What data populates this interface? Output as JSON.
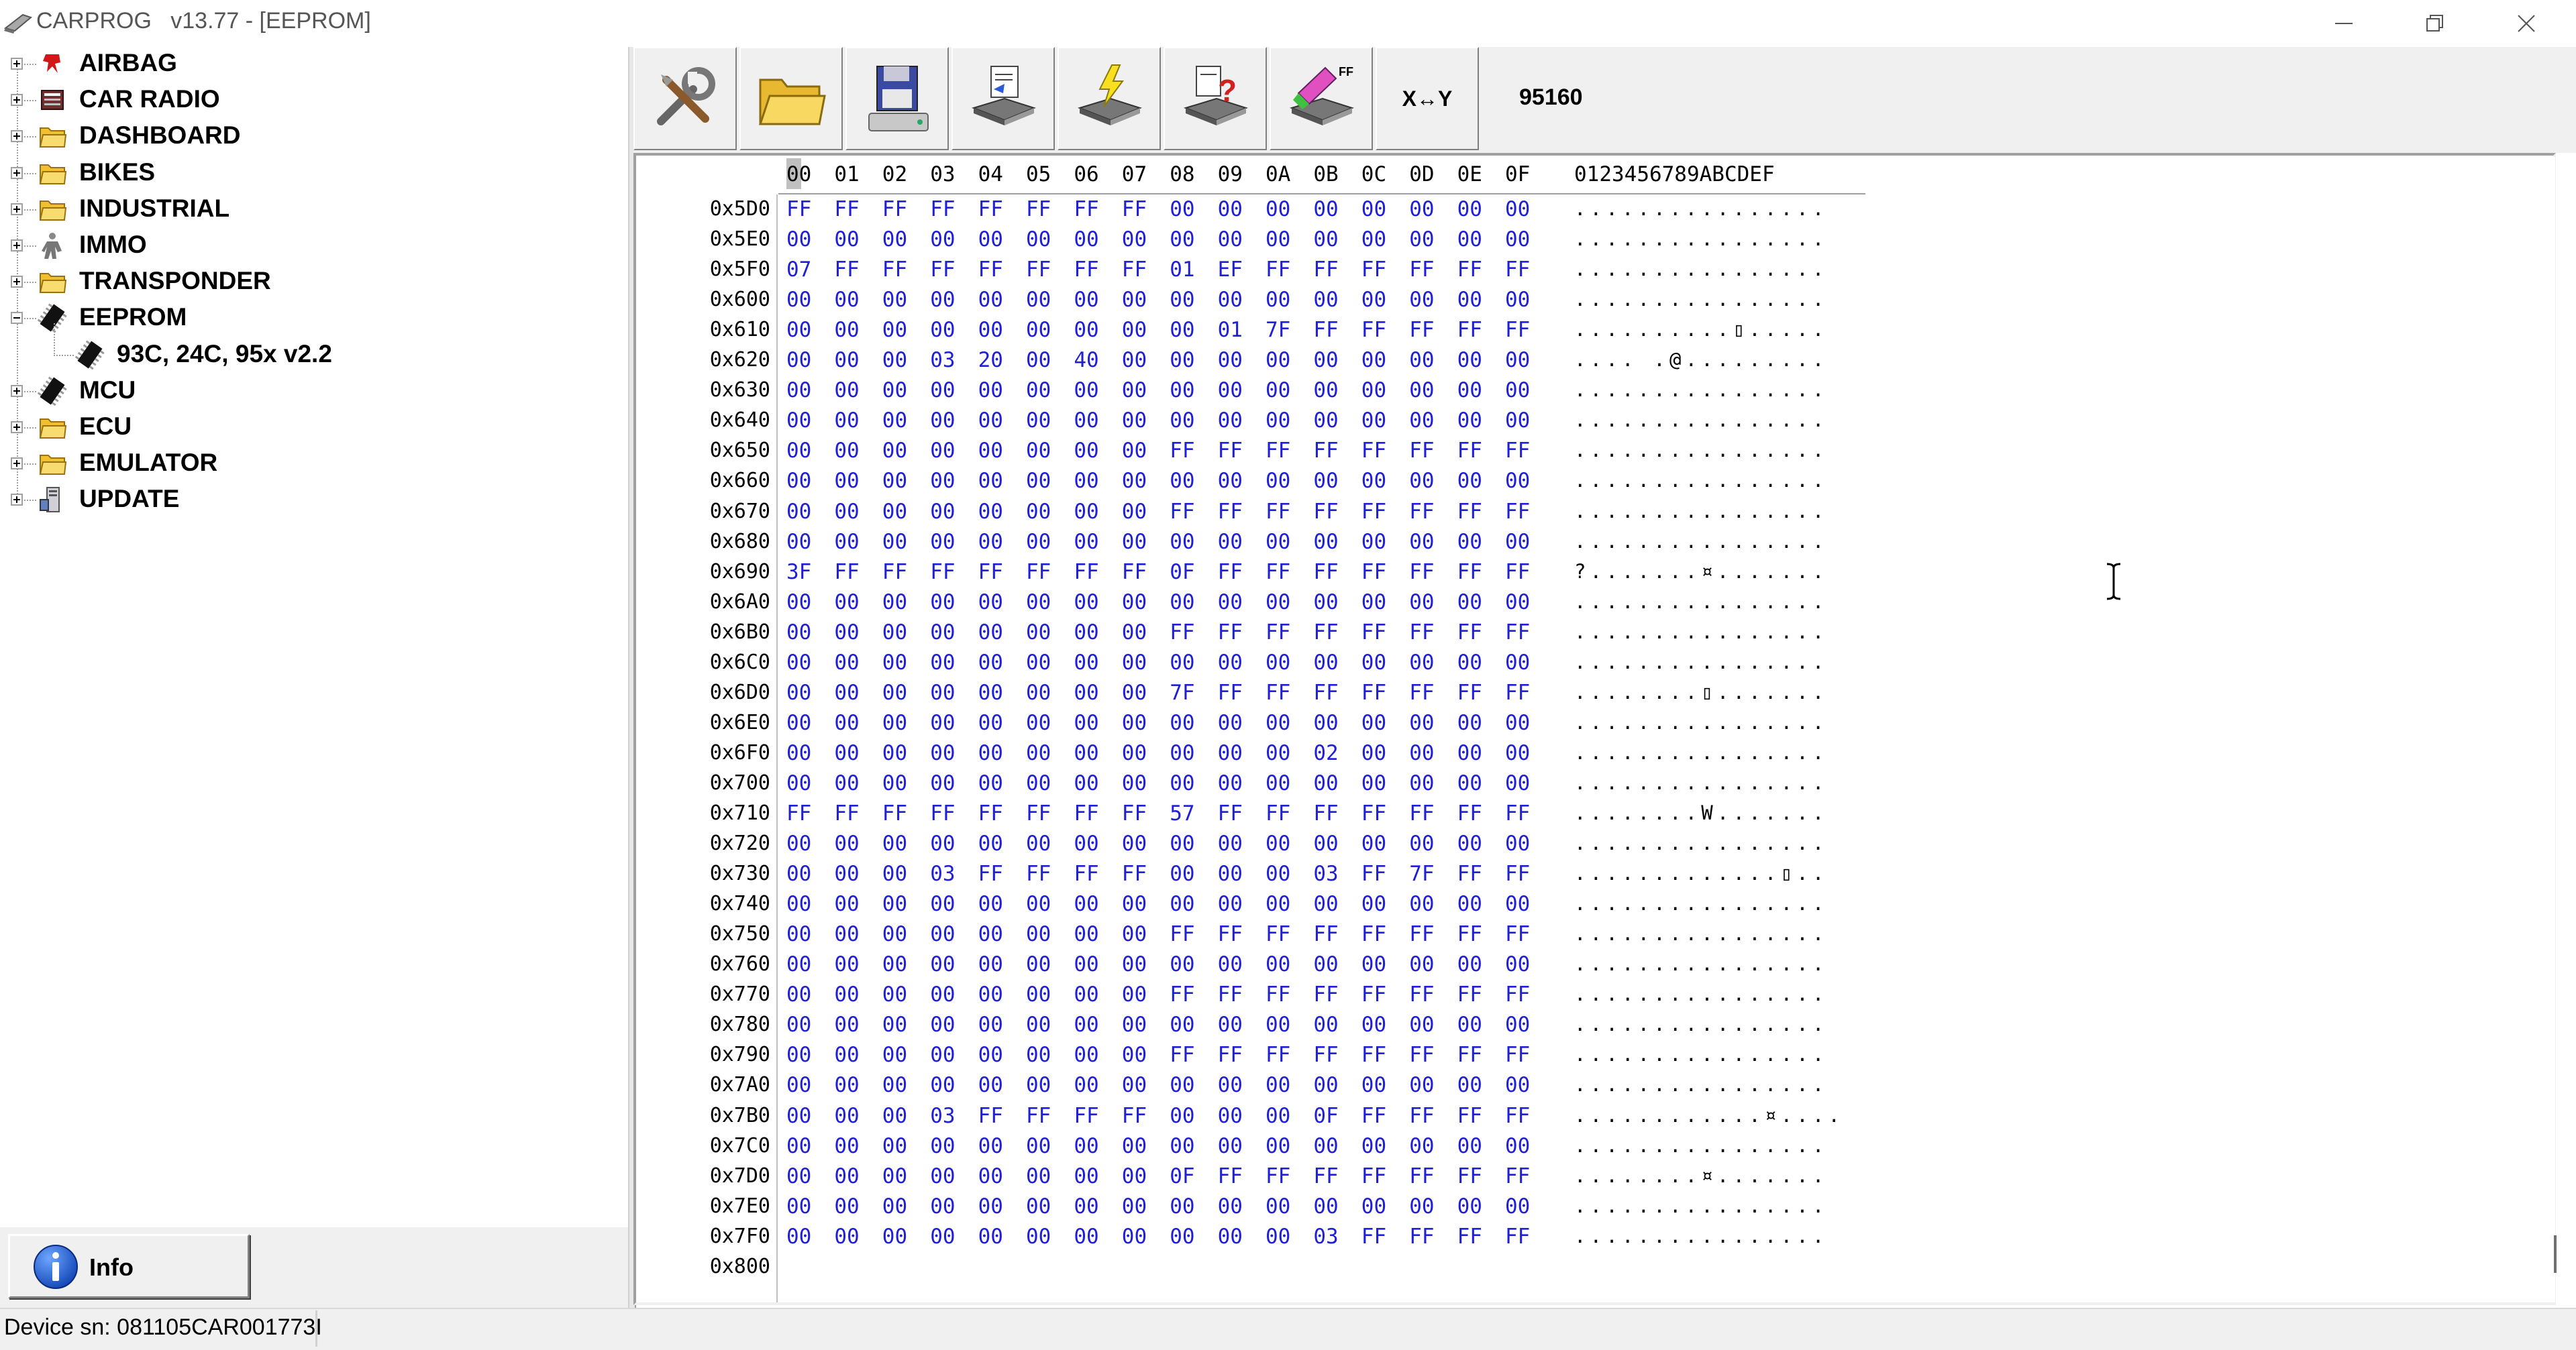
{
  "window": {
    "app_name": "CARPROG",
    "title": "CARPROG   v13.77 - [EEPROM]"
  },
  "tree": {
    "items": [
      {
        "label": "AIRBAG",
        "icon": "airbag-icon",
        "expander": "plus"
      },
      {
        "label": "CAR RADIO",
        "icon": "car-radio-icon",
        "expander": "plus"
      },
      {
        "label": "DASHBOARD",
        "icon": "folder-icon",
        "expander": "plus"
      },
      {
        "label": "BIKES",
        "icon": "folder-icon",
        "expander": "plus"
      },
      {
        "label": "INDUSTRIAL",
        "icon": "folder-icon",
        "expander": "plus"
      },
      {
        "label": "IMMO",
        "icon": "immo-icon",
        "expander": "plus"
      },
      {
        "label": "TRANSPONDER",
        "icon": "folder-icon",
        "expander": "plus"
      },
      {
        "label": "EEPROM",
        "icon": "chip-icon",
        "expander": "minus"
      },
      {
        "label": "93C, 24C, 95x v2.2",
        "icon": "chip-icon",
        "expander": "none"
      },
      {
        "label": "MCU",
        "icon": "chip-icon",
        "expander": "plus"
      },
      {
        "label": "ECU",
        "icon": "folder-icon",
        "expander": "plus"
      },
      {
        "label": "EMULATOR",
        "icon": "folder-icon",
        "expander": "plus"
      },
      {
        "label": "UPDATE",
        "icon": "update-icon",
        "expander": "plus"
      }
    ]
  },
  "info_button": {
    "label": "Info"
  },
  "toolbar": {
    "buttons": [
      {
        "name": "settings-tools-button",
        "icon": "tools-icon"
      },
      {
        "name": "open-file-button",
        "icon": "folder-open-icon"
      },
      {
        "name": "save-file-button",
        "icon": "save-icon"
      },
      {
        "name": "read-chip-button",
        "icon": "read-chip-icon"
      },
      {
        "name": "write-chip-button",
        "icon": "write-chip-icon"
      },
      {
        "name": "verify-chip-button",
        "icon": "verify-chip-icon"
      },
      {
        "name": "erase-chip-button",
        "icon": "erase-chip-icon"
      },
      {
        "name": "swap-xy-button",
        "label": "X↔Y"
      }
    ],
    "device_id": "95160"
  },
  "hex_view": {
    "header": [
      "00",
      "01",
      "02",
      "03",
      "04",
      "05",
      "06",
      "07",
      "08",
      "09",
      "0A",
      "0B",
      "0C",
      "0D",
      "0E",
      "0F"
    ],
    "ascii_header": "0123456789ABCDEF",
    "rows": [
      {
        "addr": "0x5D0",
        "bytes": [
          "FF",
          "FF",
          "FF",
          "FF",
          "FF",
          "FF",
          "FF",
          "FF",
          "00",
          "00",
          "00",
          "00",
          "00",
          "00",
          "00",
          "00"
        ],
        "ascii": "................"
      },
      {
        "addr": "0x5E0",
        "bytes": [
          "00",
          "00",
          "00",
          "00",
          "00",
          "00",
          "00",
          "00",
          "00",
          "00",
          "00",
          "00",
          "00",
          "00",
          "00",
          "00"
        ],
        "ascii": "................"
      },
      {
        "addr": "0x5F0",
        "bytes": [
          "07",
          "FF",
          "FF",
          "FF",
          "FF",
          "FF",
          "FF",
          "FF",
          "01",
          "EF",
          "FF",
          "FF",
          "FF",
          "FF",
          "FF",
          "FF"
        ],
        "ascii": "................"
      },
      {
        "addr": "0x600",
        "bytes": [
          "00",
          "00",
          "00",
          "00",
          "00",
          "00",
          "00",
          "00",
          "00",
          "00",
          "00",
          "00",
          "00",
          "00",
          "00",
          "00"
        ],
        "ascii": "................"
      },
      {
        "addr": "0x610",
        "bytes": [
          "00",
          "00",
          "00",
          "00",
          "00",
          "00",
          "00",
          "00",
          "00",
          "01",
          "7F",
          "FF",
          "FF",
          "FF",
          "FF",
          "FF"
        ],
        "ascii": "..........▯....."
      },
      {
        "addr": "0x620",
        "bytes": [
          "00",
          "00",
          "00",
          "03",
          "20",
          "00",
          "40",
          "00",
          "00",
          "00",
          "00",
          "00",
          "00",
          "00",
          "00",
          "00"
        ],
        "ascii": ".... .@........."
      },
      {
        "addr": "0x630",
        "bytes": [
          "00",
          "00",
          "00",
          "00",
          "00",
          "00",
          "00",
          "00",
          "00",
          "00",
          "00",
          "00",
          "00",
          "00",
          "00",
          "00"
        ],
        "ascii": "................"
      },
      {
        "addr": "0x640",
        "bytes": [
          "00",
          "00",
          "00",
          "00",
          "00",
          "00",
          "00",
          "00",
          "00",
          "00",
          "00",
          "00",
          "00",
          "00",
          "00",
          "00"
        ],
        "ascii": "................"
      },
      {
        "addr": "0x650",
        "bytes": [
          "00",
          "00",
          "00",
          "00",
          "00",
          "00",
          "00",
          "00",
          "FF",
          "FF",
          "FF",
          "FF",
          "FF",
          "FF",
          "FF",
          "FF"
        ],
        "ascii": "................"
      },
      {
        "addr": "0x660",
        "bytes": [
          "00",
          "00",
          "00",
          "00",
          "00",
          "00",
          "00",
          "00",
          "00",
          "00",
          "00",
          "00",
          "00",
          "00",
          "00",
          "00"
        ],
        "ascii": "................"
      },
      {
        "addr": "0x670",
        "bytes": [
          "00",
          "00",
          "00",
          "00",
          "00",
          "00",
          "00",
          "00",
          "FF",
          "FF",
          "FF",
          "FF",
          "FF",
          "FF",
          "FF",
          "FF"
        ],
        "ascii": "................"
      },
      {
        "addr": "0x680",
        "bytes": [
          "00",
          "00",
          "00",
          "00",
          "00",
          "00",
          "00",
          "00",
          "00",
          "00",
          "00",
          "00",
          "00",
          "00",
          "00",
          "00"
        ],
        "ascii": "................"
      },
      {
        "addr": "0x690",
        "bytes": [
          "3F",
          "FF",
          "FF",
          "FF",
          "FF",
          "FF",
          "FF",
          "FF",
          "0F",
          "FF",
          "FF",
          "FF",
          "FF",
          "FF",
          "FF",
          "FF"
        ],
        "ascii": "?.......¤......."
      },
      {
        "addr": "0x6A0",
        "bytes": [
          "00",
          "00",
          "00",
          "00",
          "00",
          "00",
          "00",
          "00",
          "00",
          "00",
          "00",
          "00",
          "00",
          "00",
          "00",
          "00"
        ],
        "ascii": "................"
      },
      {
        "addr": "0x6B0",
        "bytes": [
          "00",
          "00",
          "00",
          "00",
          "00",
          "00",
          "00",
          "00",
          "FF",
          "FF",
          "FF",
          "FF",
          "FF",
          "FF",
          "FF",
          "FF"
        ],
        "ascii": "................"
      },
      {
        "addr": "0x6C0",
        "bytes": [
          "00",
          "00",
          "00",
          "00",
          "00",
          "00",
          "00",
          "00",
          "00",
          "00",
          "00",
          "00",
          "00",
          "00",
          "00",
          "00"
        ],
        "ascii": "................"
      },
      {
        "addr": "0x6D0",
        "bytes": [
          "00",
          "00",
          "00",
          "00",
          "00",
          "00",
          "00",
          "00",
          "7F",
          "FF",
          "FF",
          "FF",
          "FF",
          "FF",
          "FF",
          "FF"
        ],
        "ascii": "........▯......."
      },
      {
        "addr": "0x6E0",
        "bytes": [
          "00",
          "00",
          "00",
          "00",
          "00",
          "00",
          "00",
          "00",
          "00",
          "00",
          "00",
          "00",
          "00",
          "00",
          "00",
          "00"
        ],
        "ascii": "................"
      },
      {
        "addr": "0x6F0",
        "bytes": [
          "00",
          "00",
          "00",
          "00",
          "00",
          "00",
          "00",
          "00",
          "00",
          "00",
          "00",
          "02",
          "00",
          "00",
          "00",
          "00"
        ],
        "ascii": "................"
      },
      {
        "addr": "0x700",
        "bytes": [
          "00",
          "00",
          "00",
          "00",
          "00",
          "00",
          "00",
          "00",
          "00",
          "00",
          "00",
          "00",
          "00",
          "00",
          "00",
          "00"
        ],
        "ascii": "................"
      },
      {
        "addr": "0x710",
        "bytes": [
          "FF",
          "FF",
          "FF",
          "FF",
          "FF",
          "FF",
          "FF",
          "FF",
          "57",
          "FF",
          "FF",
          "FF",
          "FF",
          "FF",
          "FF",
          "FF"
        ],
        "ascii": "........W......."
      },
      {
        "addr": "0x720",
        "bytes": [
          "00",
          "00",
          "00",
          "00",
          "00",
          "00",
          "00",
          "00",
          "00",
          "00",
          "00",
          "00",
          "00",
          "00",
          "00",
          "00"
        ],
        "ascii": "................"
      },
      {
        "addr": "0x730",
        "bytes": [
          "00",
          "00",
          "00",
          "03",
          "FF",
          "FF",
          "FF",
          "FF",
          "00",
          "00",
          "00",
          "03",
          "FF",
          "7F",
          "FF",
          "FF"
        ],
        "ascii": ".............▯.."
      },
      {
        "addr": "0x740",
        "bytes": [
          "00",
          "00",
          "00",
          "00",
          "00",
          "00",
          "00",
          "00",
          "00",
          "00",
          "00",
          "00",
          "00",
          "00",
          "00",
          "00"
        ],
        "ascii": "................"
      },
      {
        "addr": "0x750",
        "bytes": [
          "00",
          "00",
          "00",
          "00",
          "00",
          "00",
          "00",
          "00",
          "FF",
          "FF",
          "FF",
          "FF",
          "FF",
          "FF",
          "FF",
          "FF"
        ],
        "ascii": "................"
      },
      {
        "addr": "0x760",
        "bytes": [
          "00",
          "00",
          "00",
          "00",
          "00",
          "00",
          "00",
          "00",
          "00",
          "00",
          "00",
          "00",
          "00",
          "00",
          "00",
          "00"
        ],
        "ascii": "................"
      },
      {
        "addr": "0x770",
        "bytes": [
          "00",
          "00",
          "00",
          "00",
          "00",
          "00",
          "00",
          "00",
          "FF",
          "FF",
          "FF",
          "FF",
          "FF",
          "FF",
          "FF",
          "FF"
        ],
        "ascii": "................"
      },
      {
        "addr": "0x780",
        "bytes": [
          "00",
          "00",
          "00",
          "00",
          "00",
          "00",
          "00",
          "00",
          "00",
          "00",
          "00",
          "00",
          "00",
          "00",
          "00",
          "00"
        ],
        "ascii": "................"
      },
      {
        "addr": "0x790",
        "bytes": [
          "00",
          "00",
          "00",
          "00",
          "00",
          "00",
          "00",
          "00",
          "FF",
          "FF",
          "FF",
          "FF",
          "FF",
          "FF",
          "FF",
          "FF"
        ],
        "ascii": "................"
      },
      {
        "addr": "0x7A0",
        "bytes": [
          "00",
          "00",
          "00",
          "00",
          "00",
          "00",
          "00",
          "00",
          "00",
          "00",
          "00",
          "00",
          "00",
          "00",
          "00",
          "00"
        ],
        "ascii": "................"
      },
      {
        "addr": "0x7B0",
        "bytes": [
          "00",
          "00",
          "00",
          "03",
          "FF",
          "FF",
          "FF",
          "FF",
          "00",
          "00",
          "00",
          "0F",
          "FF",
          "FF",
          "FF",
          "FF"
        ],
        "ascii": "............¤...."
      },
      {
        "addr": "0x7C0",
        "bytes": [
          "00",
          "00",
          "00",
          "00",
          "00",
          "00",
          "00",
          "00",
          "00",
          "00",
          "00",
          "00",
          "00",
          "00",
          "00",
          "00"
        ],
        "ascii": "................"
      },
      {
        "addr": "0x7D0",
        "bytes": [
          "00",
          "00",
          "00",
          "00",
          "00",
          "00",
          "00",
          "00",
          "0F",
          "FF",
          "FF",
          "FF",
          "FF",
          "FF",
          "FF",
          "FF"
        ],
        "ascii": "........¤......."
      },
      {
        "addr": "0x7E0",
        "bytes": [
          "00",
          "00",
          "00",
          "00",
          "00",
          "00",
          "00",
          "00",
          "00",
          "00",
          "00",
          "00",
          "00",
          "00",
          "00",
          "00"
        ],
        "ascii": "................"
      },
      {
        "addr": "0x7F0",
        "bytes": [
          "00",
          "00",
          "00",
          "00",
          "00",
          "00",
          "00",
          "00",
          "00",
          "00",
          "00",
          "03",
          "FF",
          "FF",
          "FF",
          "FF"
        ],
        "ascii": "................"
      },
      {
        "addr": "0x800",
        "bytes": [],
        "ascii": ""
      }
    ]
  },
  "status_bar": {
    "device_sn": "Device sn: 081105CAR001773I"
  },
  "colors": {
    "hex_bytes": "#1f1fd6",
    "chrome": "#f0f0f0"
  }
}
